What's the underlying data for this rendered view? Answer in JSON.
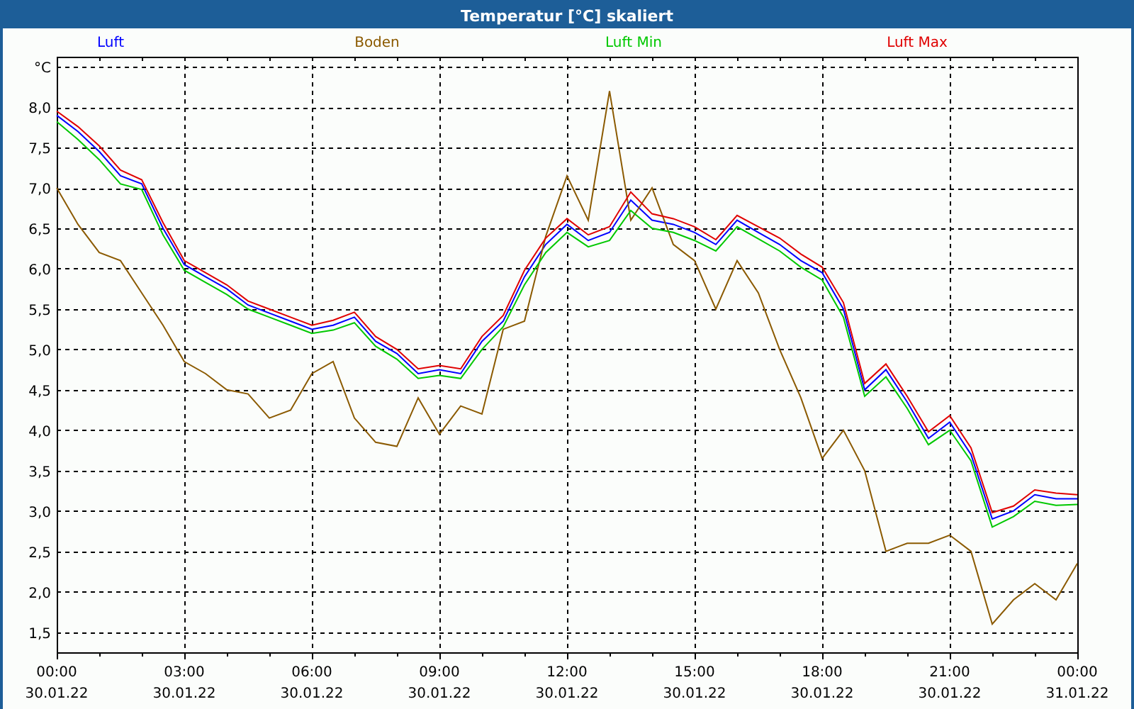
{
  "window": {
    "title": "Temperatur [°C] skaliert"
  },
  "chart": {
    "chart_data": {
      "type": "line",
      "ylabel": "°C",
      "categories": [
        "00:00\n30.01.22",
        null,
        null,
        null,
        null,
        null,
        "03:00\n30.01.22",
        null,
        null,
        null,
        null,
        null,
        "06:00\n30.01.22",
        null,
        null,
        null,
        null,
        null,
        "09:00\n30.01.22",
        null,
        null,
        null,
        null,
        null,
        "12:00\n30.01.22",
        null,
        null,
        null,
        null,
        null,
        "15:00\n30.01.22",
        null,
        null,
        null,
        null,
        null,
        "18:00\n30.01.22",
        null,
        null,
        null,
        null,
        null,
        "21:00\n30.01.22",
        null,
        null,
        null,
        null,
        null,
        "00:00\n31.01.22"
      ],
      "series": [
        {
          "name": "Luft",
          "color": "#0000ff",
          "values": [
            7.9,
            7.7,
            7.45,
            7.15,
            7.05,
            6.5,
            6.05,
            5.9,
            5.75,
            5.55,
            5.45,
            5.35,
            5.25,
            5.3,
            5.4,
            5.1,
            4.95,
            4.7,
            4.75,
            4.7,
            5.1,
            5.35,
            5.9,
            6.3,
            6.55,
            6.35,
            6.45,
            6.85,
            6.6,
            6.55,
            6.45,
            6.3,
            6.6,
            6.45,
            6.3,
            6.1,
            5.95,
            5.5,
            4.5,
            4.75,
            4.35,
            3.9,
            4.1,
            3.7,
            2.9,
            3.0,
            3.2,
            3.15,
            3.15
          ]
        },
        {
          "name": "Boden",
          "color": "#8b5a00",
          "values": [
            7.0,
            6.55,
            6.2,
            6.1,
            5.7,
            5.3,
            4.85,
            4.7,
            4.5,
            4.45,
            4.15,
            4.25,
            4.7,
            4.85,
            4.15,
            3.85,
            3.8,
            4.4,
            3.95,
            4.3,
            4.2,
            5.25,
            5.35,
            6.4,
            7.15,
            6.6,
            8.2,
            6.6,
            7.0,
            6.3,
            6.1,
            5.5,
            6.1,
            5.7,
            5.0,
            4.4,
            3.65,
            4.0,
            3.5,
            2.5,
            2.6,
            2.6,
            2.7,
            2.5,
            1.6,
            1.9,
            2.1,
            1.9,
            2.35
          ]
        },
        {
          "name": "Luft Min",
          "color": "#00c800",
          "values": [
            7.82,
            7.6,
            7.35,
            7.05,
            6.98,
            6.42,
            5.98,
            5.83,
            5.68,
            5.5,
            5.4,
            5.3,
            5.2,
            5.24,
            5.33,
            5.04,
            4.88,
            4.64,
            4.68,
            4.64,
            5.0,
            5.28,
            5.8,
            6.2,
            6.45,
            6.27,
            6.35,
            6.72,
            6.5,
            6.45,
            6.35,
            6.22,
            6.52,
            6.37,
            6.22,
            6.02,
            5.86,
            5.4,
            4.42,
            4.66,
            4.27,
            3.82,
            4.0,
            3.62,
            2.8,
            2.93,
            3.12,
            3.07,
            3.08
          ]
        },
        {
          "name": "Luft Max",
          "color": "#e00000",
          "values": [
            7.95,
            7.76,
            7.52,
            7.22,
            7.1,
            6.57,
            6.1,
            5.95,
            5.8,
            5.6,
            5.5,
            5.4,
            5.3,
            5.36,
            5.46,
            5.16,
            5.0,
            4.76,
            4.8,
            4.76,
            5.16,
            5.42,
            5.98,
            6.38,
            6.62,
            6.42,
            6.52,
            6.95,
            6.68,
            6.62,
            6.52,
            6.36,
            6.66,
            6.52,
            6.38,
            6.18,
            6.02,
            5.58,
            4.58,
            4.82,
            4.42,
            3.98,
            4.18,
            3.78,
            2.98,
            3.06,
            3.26,
            3.22,
            3.2
          ]
        }
      ],
      "ylim": [
        1.25,
        8.625
      ],
      "grid": true,
      "yticks": [
        {
          "value": 1.5,
          "label": "1,5"
        },
        {
          "value": 2,
          "label": "2,0"
        },
        {
          "value": 2.5,
          "label": "2,5"
        },
        {
          "value": 3,
          "label": "3,0"
        },
        {
          "value": 3.5,
          "label": "3,5"
        },
        {
          "value": 4,
          "label": "4,0"
        },
        {
          "value": 4.5,
          "label": "4,5"
        },
        {
          "value": 5,
          "label": "5,0"
        },
        {
          "value": 5.5,
          "label": "5,5"
        },
        {
          "value": 6,
          "label": "6,0"
        },
        {
          "value": 6.5,
          "label": "6,5"
        },
        {
          "value": 7,
          "label": "7,0"
        },
        {
          "value": 7.5,
          "label": "7,5"
        },
        {
          "value": 8,
          "label": "8,0"
        }
      ]
    }
  }
}
